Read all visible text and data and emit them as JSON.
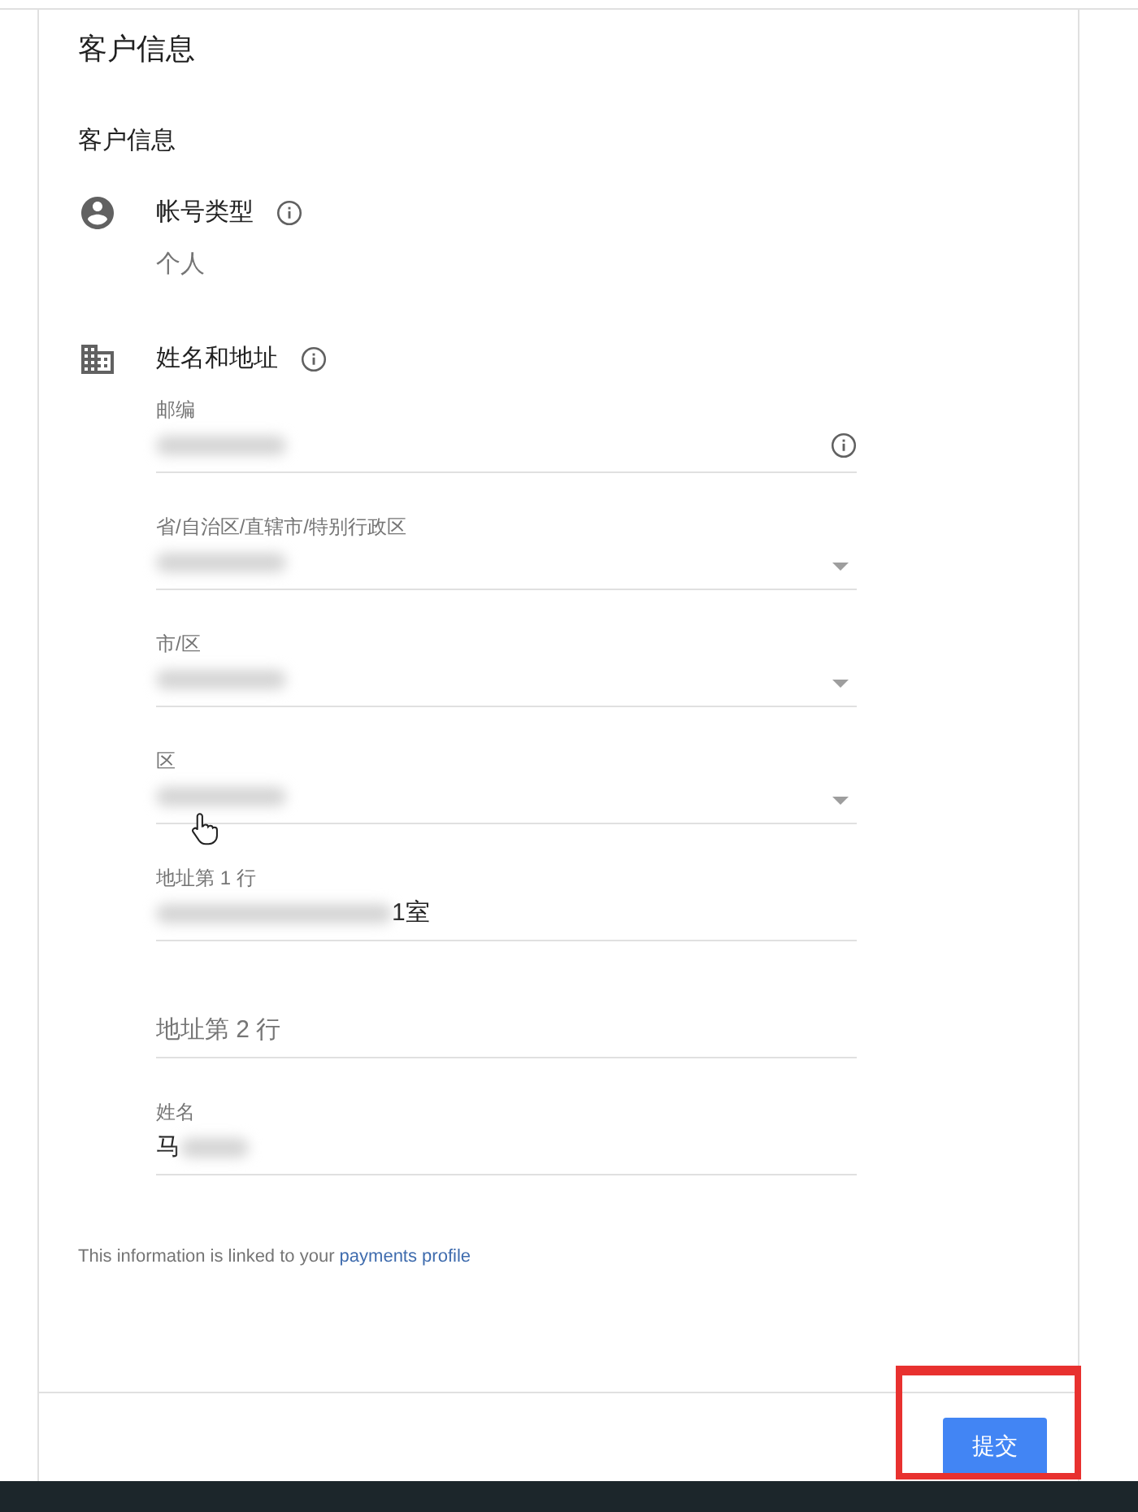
{
  "title": "客户信息",
  "subheading": "客户信息",
  "sections": [
    {
      "kind": "account",
      "label": "帐号类型",
      "value": "个人"
    },
    {
      "kind": "address",
      "label": "姓名和地址",
      "fields": [
        {
          "kind": "info-text",
          "label": "邮编",
          "content": [
            {
              "kind": "blur"
            }
          ]
        },
        {
          "kind": "select",
          "label": "省/自治区/直辖市/特别行政区",
          "content": [
            {
              "kind": "blur"
            }
          ]
        },
        {
          "kind": "select",
          "label": "市/区",
          "content": [
            {
              "kind": "blur"
            }
          ]
        },
        {
          "kind": "select",
          "label": "区",
          "content": [
            {
              "kind": "blur"
            }
          ]
        },
        {
          "kind": "text",
          "label": "地址第 1 行",
          "content": [
            {
              "kind": "blur"
            },
            {
              "kind": "text",
              "text": "1室"
            }
          ]
        },
        {
          "kind": "text",
          "placeholder": "地址第 2 行"
        },
        {
          "kind": "text",
          "label": "姓名",
          "content": [
            {
              "kind": "text",
              "text": "马"
            },
            {
              "kind": "blur"
            }
          ]
        }
      ]
    }
  ],
  "note": {
    "text": "This information is linked to your ",
    "link": "payments profile"
  },
  "submit_button": "提交"
}
